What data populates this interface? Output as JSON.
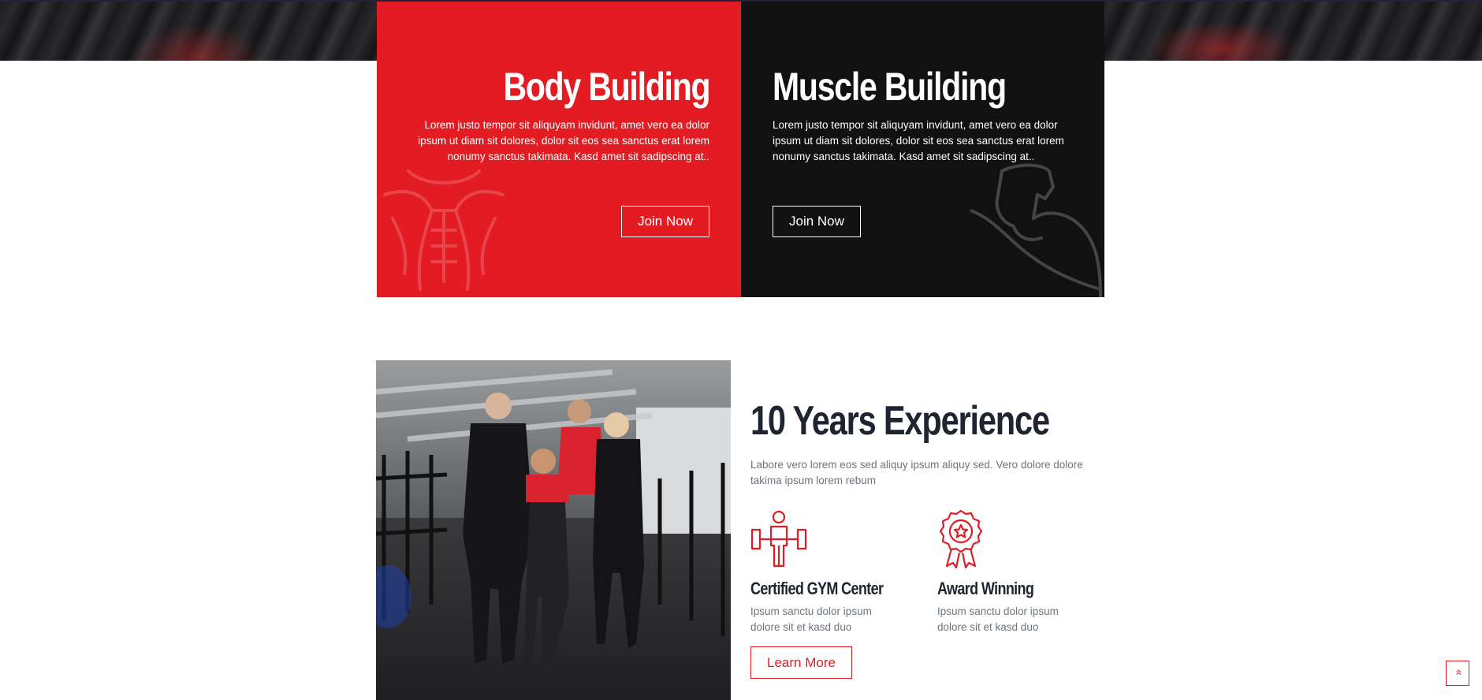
{
  "cards": {
    "body_building": {
      "title": "Body Building",
      "text": "Lorem justo tempor sit aliquyam invidunt, amet vero ea dolor ipsum ut diam sit dolores, dolor sit eos sea sanctus erat lorem nonumy sanctus takimata. Kasd amet sit sadipscing at..",
      "button": "Join Now"
    },
    "muscle_building": {
      "title": "Muscle Building",
      "text": "Lorem justo tempor sit aliquyam invidunt, amet vero ea dolor ipsum ut diam sit dolores, dolor sit eos sea sanctus erat lorem nonumy sanctus takimata. Kasd amet sit sadipscing at..",
      "button": "Join Now"
    }
  },
  "about": {
    "title": "10 Years Experience",
    "description": "Labore vero lorem eos sed aliquy ipsum aliquy sed. Vero dolore dolore takima ipsum lorem rebum",
    "features": [
      {
        "title": "Certified GYM Center",
        "text": "Ipsum sanctu dolor ipsum dolore sit et kasd duo",
        "icon": "weightlifter-icon"
      },
      {
        "title": "Award Winning",
        "text": "Ipsum sanctu dolor ipsum dolore sit et kasd duo",
        "icon": "award-medal-icon"
      }
    ],
    "button": "Learn More"
  },
  "back_to_top": {
    "icon": "double-chevron-up-icon",
    "glyph": "»"
  },
  "colors": {
    "accent": "#e31b23",
    "dark": "#111111",
    "heading": "#1e2530",
    "muted": "#6c757d"
  }
}
